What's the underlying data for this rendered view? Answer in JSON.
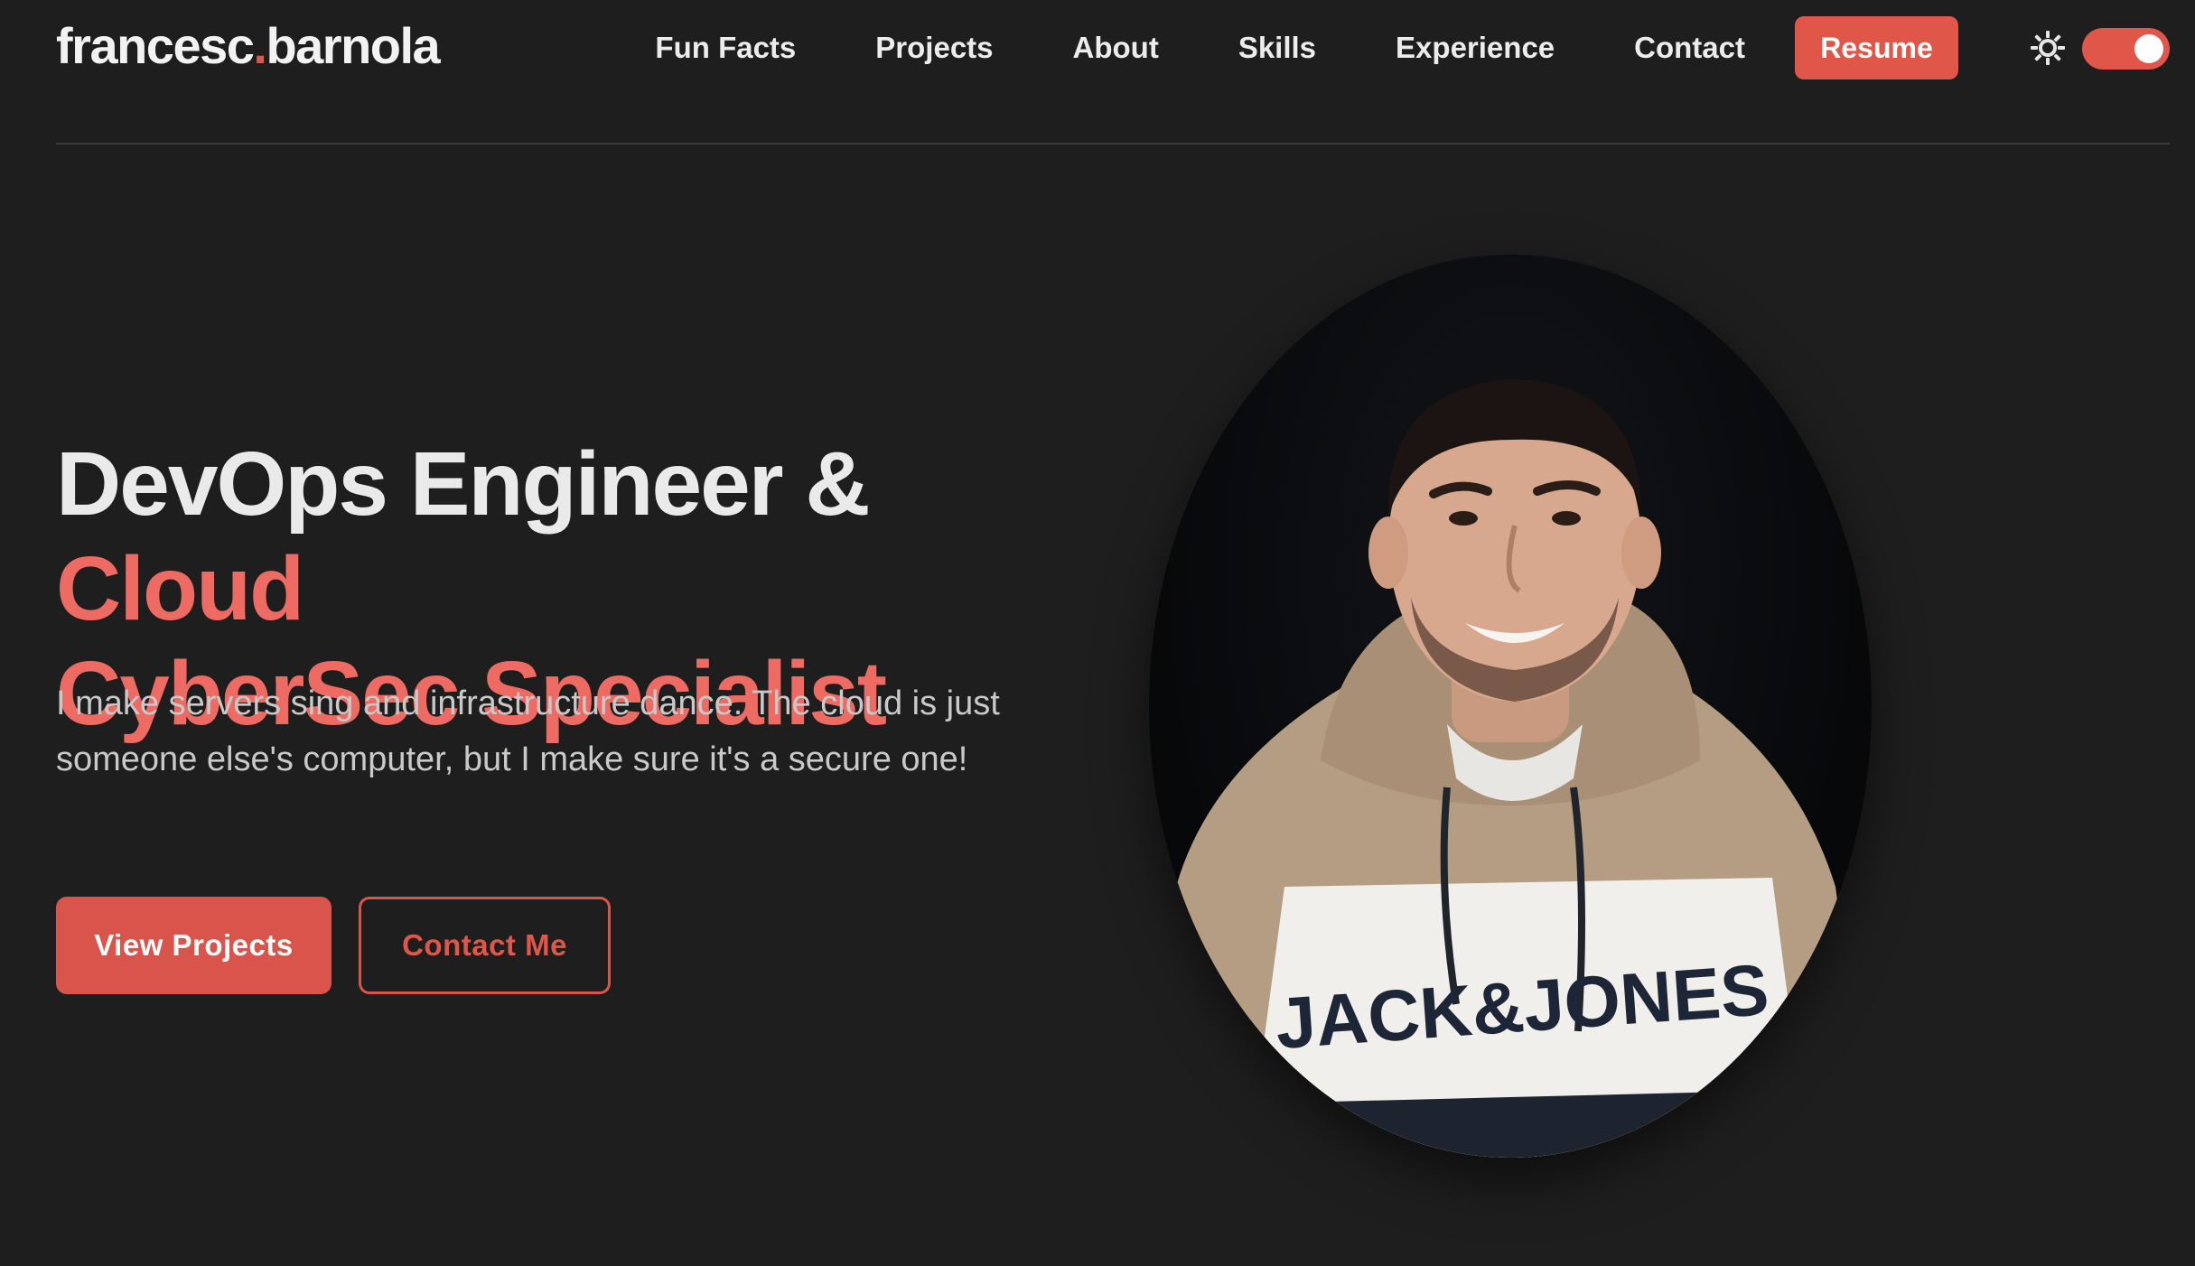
{
  "brand": {
    "name_part1": "francesc",
    "dot": ".",
    "name_part2": "barnola"
  },
  "nav": {
    "items": [
      {
        "label": "Fun Facts"
      },
      {
        "label": "Projects"
      },
      {
        "label": "About"
      },
      {
        "label": "Skills"
      },
      {
        "label": "Experience"
      },
      {
        "label": "Contact"
      }
    ],
    "resume_label": "Resume",
    "theme_icon": "sun-icon",
    "theme_toggle_on": true
  },
  "hero": {
    "title_plain": "DevOps Engineer & ",
    "title_accent_1": "Cloud",
    "title_accent_2": "CyberSec Specialist",
    "subtitle": "I make servers sing and infrastructure dance. The cloud is just someone else's computer, but I make sure it's a secure one!",
    "primary_button": "View Projects",
    "secondary_button": "Contact Me"
  },
  "portrait": {
    "hoodie_brand": "JACK&JONES"
  },
  "colors": {
    "accent": "#e0574a",
    "accent_text": "#ee6b63",
    "background": "#1e1e1e"
  }
}
